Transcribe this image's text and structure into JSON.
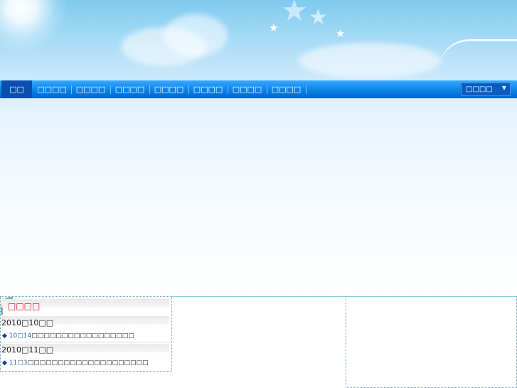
{
  "nav": {
    "items": [
      {
        "label": "□□"
      },
      {
        "label": "□□□□"
      },
      {
        "label": "□□□□"
      },
      {
        "label": "□□□□"
      },
      {
        "label": "□□□□"
      },
      {
        "label": "□□□□"
      },
      {
        "label": "□□□□"
      },
      {
        "label": "□□□□"
      }
    ],
    "select_value": "□□□□"
  },
  "news_panel": {
    "title": "□□□□",
    "groups": [
      {
        "heading": "2010□10□□",
        "items": [
          {
            "date": "10□14",
            "text": "□□□□□□□□□□□□□□□□□"
          }
        ]
      },
      {
        "heading": "2010□11□□",
        "items": [
          {
            "date": "11□3",
            "text": "□□□□□□□□□□□□□□□□□□□□"
          }
        ]
      }
    ]
  },
  "colors": {
    "nav_active": "#0a4fb0",
    "nav_bar": "#0c86ec",
    "panel_title": "#e00000"
  }
}
